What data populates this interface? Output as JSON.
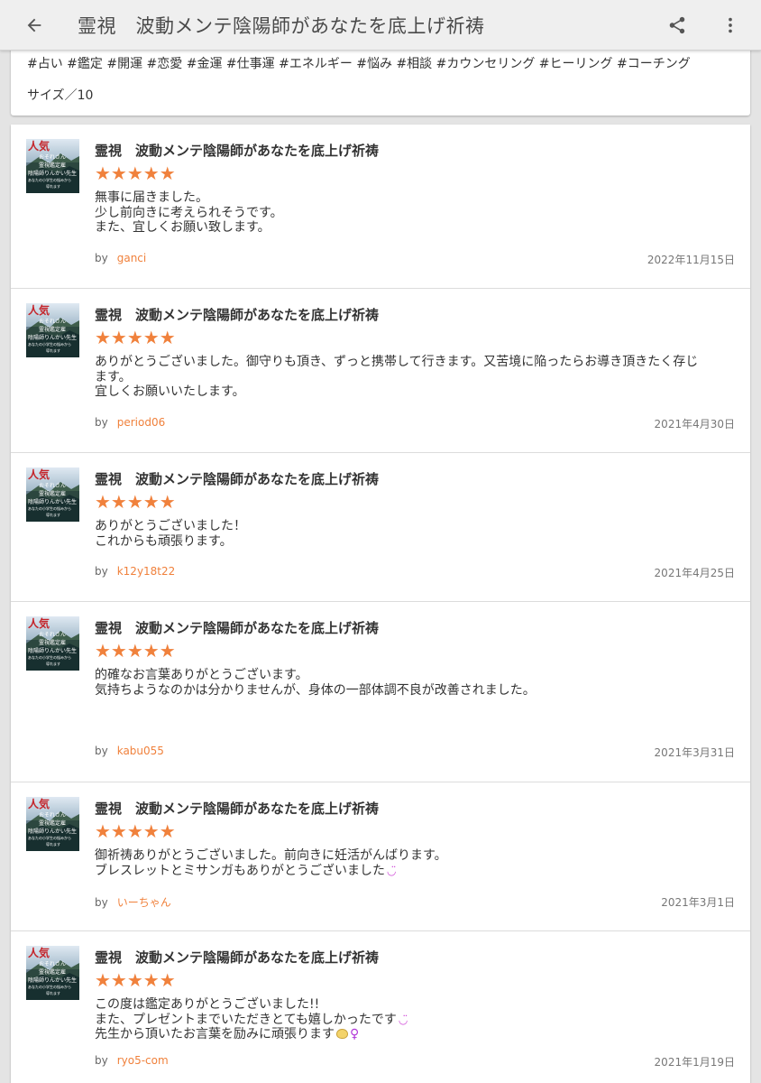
{
  "appbar": {
    "title": "霊視　波動メンテ陰陽師があなたを底上げ祈祷",
    "back_icon": "arrow-left-icon",
    "share_icon": "share-icon",
    "more_icon": "more-vert-icon"
  },
  "tags": {
    "line": "#占い #鑑定 #開運 #恋愛 #金運 #仕事運 #エネルギー #悩み #相談 #カウンセリング #ヒーリング #コーチング",
    "size": "サイズ／10"
  },
  "thumbnail": {
    "badge": "人気",
    "line1": "おそれさん",
    "line2": "霊視鑑定雇",
    "line3": "陰陽師りんかい先生",
    "line4": "あなたの小学生の悩みから",
    "line5": "導れます"
  },
  "reviews": [
    {
      "title": "霊視　波動メンテ陰陽師があなたを底上げ祈祷",
      "stars": "★★★★★",
      "rating": 5,
      "lines": [
        "無事に届きました。",
        "少し前向きに考えられそうです。",
        "また、宜しくお願い致します。"
      ],
      "by": "by",
      "user": "ganci",
      "date": "2022年11月15日"
    },
    {
      "title": "霊視　波動メンテ陰陽師があなたを底上げ祈祷",
      "stars": "★★★★★",
      "rating": 5,
      "lines": [
        "ありがとうございました。御守りも頂き、ずっと携帯して行きます。又苦境に陥ったらお導き頂きたく存じ",
        "ます。",
        "宜しくお願いいたします。"
      ],
      "by": "by",
      "user": "period06",
      "date": "2021年4月30日"
    },
    {
      "title": "霊視　波動メンテ陰陽師があなたを底上げ祈祷",
      "stars": "★★★★★",
      "rating": 5,
      "lines": [
        "ありがとうございました！",
        "これからも頑張ります。"
      ],
      "by": "by",
      "user": "k12y18t22",
      "date": "2021年4月25日"
    },
    {
      "title": "霊視　波動メンテ陰陽師があなたを底上げ祈祷",
      "stars": "★★★★★",
      "rating": 5,
      "lines": [
        "的確なお言葉ありがとうございます。",
        "気持ちようなのかは分かりませんが、身体の一部体調不良が改善されました。"
      ],
      "by": "by",
      "user": "kabu055",
      "date": "2021年3月31日"
    },
    {
      "title": "霊視　波動メンテ陰陽師があなたを底上げ祈祷",
      "stars": "★★★★★",
      "rating": 5,
      "lines": [
        "御祈祷ありがとうございました。前向きに妊活がんばります。",
        "ブレスレットとミサンガもありがとうございました"
      ],
      "emoji": [
        "smile-emoji"
      ],
      "by": "by",
      "user": "いーちゃん",
      "date": "2021年3月1日"
    },
    {
      "title": "霊視　波動メンテ陰陽師があなたを底上げ祈祷",
      "stars": "★★★★★",
      "rating": 5,
      "lines": [
        "この度は鑑定ありがとうございました!!",
        "また、プレゼントまでいただきとても嬉しかったです",
        "先生から頂いたお言葉を励みに頑張ります"
      ],
      "emoji": [
        "smile-emoji",
        "smile-emoji",
        "money-bag-emoji",
        "female-sign-emoji"
      ],
      "by": "by",
      "user": "ryo5-com",
      "date": "2021年1月19日"
    }
  ],
  "colors": {
    "accent": "#f0813c",
    "appbar_bg": "#efefef",
    "page_bg": "#e4e4e4"
  }
}
